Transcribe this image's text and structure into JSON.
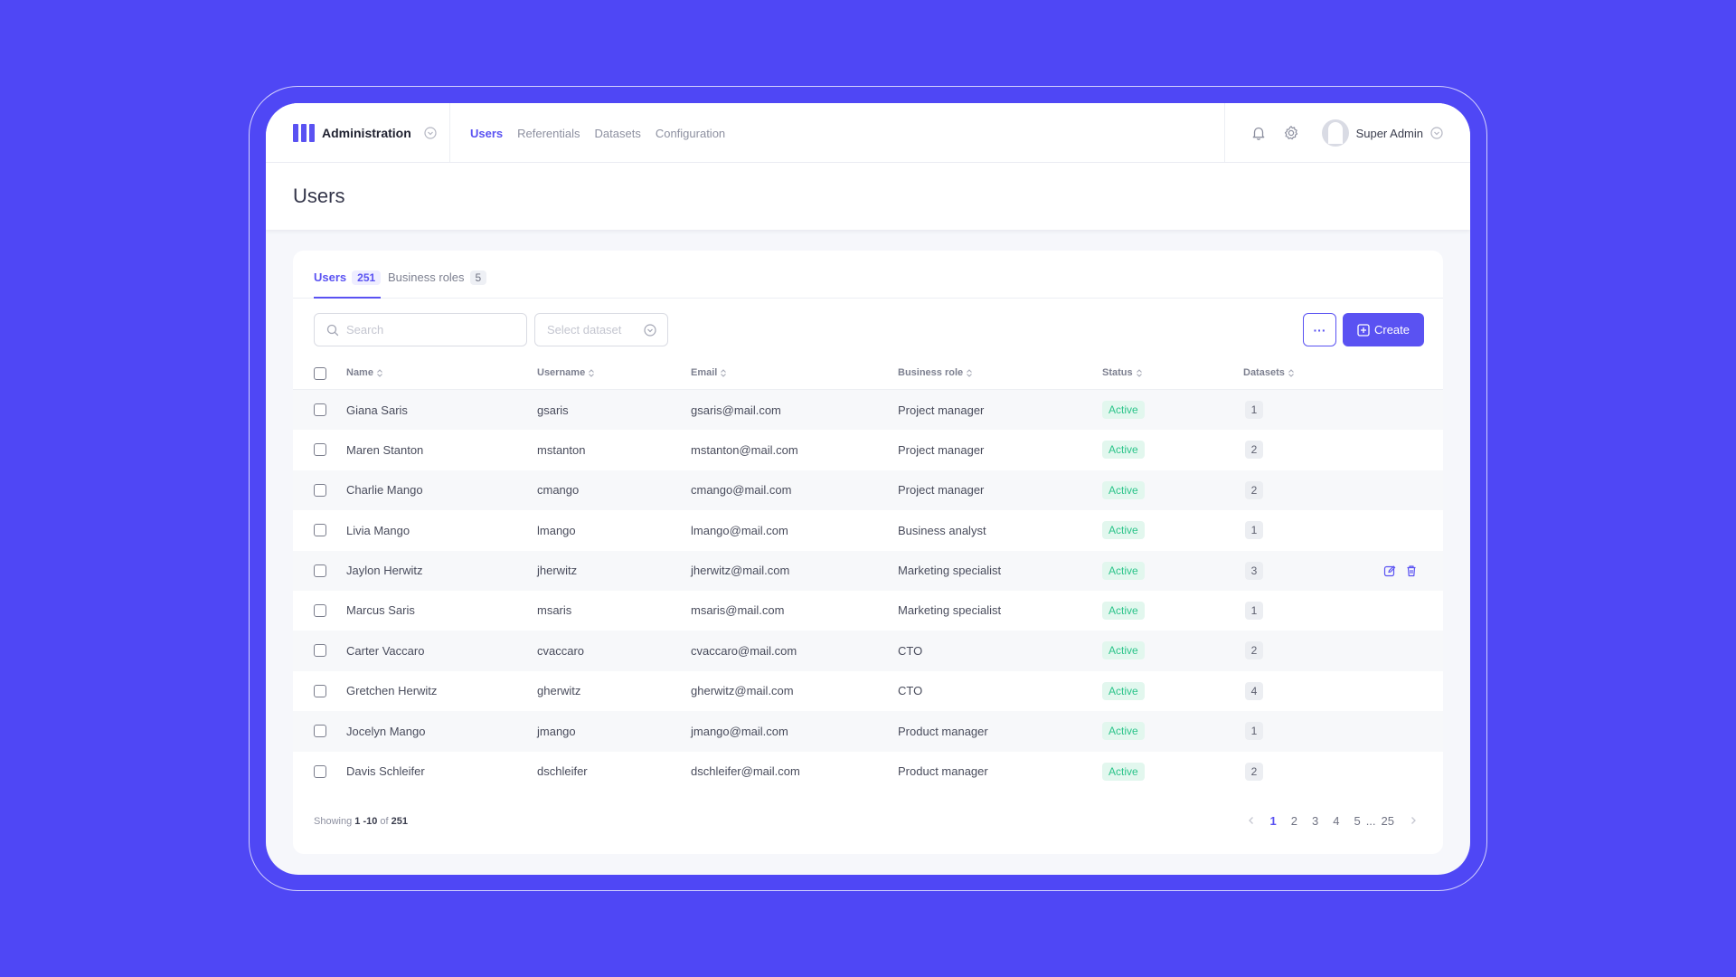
{
  "brand": {
    "name": "Administration"
  },
  "nav": [
    {
      "label": "Users",
      "active": true
    },
    {
      "label": "Referentials"
    },
    {
      "label": "Datasets"
    },
    {
      "label": "Configuration"
    }
  ],
  "user": {
    "name": "Super Admin"
  },
  "page": {
    "title": "Users"
  },
  "tabs": [
    {
      "label": "Users",
      "count": "251",
      "active": true
    },
    {
      "label": "Business roles",
      "count": "5"
    }
  ],
  "toolbar": {
    "search_placeholder": "Search",
    "dataset_placeholder": "Select dataset",
    "more_label": "···",
    "create_label": "Create"
  },
  "table": {
    "headers": [
      "Name",
      "Username",
      "Email",
      "Business role",
      "Status",
      "Datasets"
    ],
    "rows": [
      {
        "name": "Giana Saris",
        "username": "gsaris",
        "email": "gsaris@mail.com",
        "role": "Project manager",
        "status": "Active",
        "datasets": "1"
      },
      {
        "name": "Maren Stanton",
        "username": "mstanton",
        "email": "mstanton@mail.com",
        "role": "Project manager",
        "status": "Active",
        "datasets": "2"
      },
      {
        "name": "Charlie Mango",
        "username": "cmango",
        "email": "cmango@mail.com",
        "role": "Project manager",
        "status": "Active",
        "datasets": "2"
      },
      {
        "name": "Livia Mango",
        "username": "lmango",
        "email": "lmango@mail.com",
        "role": "Business analyst",
        "status": "Active",
        "datasets": "1"
      },
      {
        "name": "Jaylon Herwitz",
        "username": "jherwitz",
        "email": "jherwitz@mail.com",
        "role": "Marketing specialist",
        "status": "Active",
        "datasets": "3",
        "show_actions": true
      },
      {
        "name": "Marcus Saris",
        "username": "msaris",
        "email": "msaris@mail.com",
        "role": "Marketing specialist",
        "status": "Active",
        "datasets": "1"
      },
      {
        "name": "Carter Vaccaro",
        "username": "cvaccaro",
        "email": "cvaccaro@mail.com",
        "role": "CTO",
        "status": "Active",
        "datasets": "2"
      },
      {
        "name": "Gretchen Herwitz",
        "username": "gherwitz",
        "email": "gherwitz@mail.com",
        "role": "CTO",
        "status": "Active",
        "datasets": "4"
      },
      {
        "name": "Jocelyn Mango",
        "username": "jmango",
        "email": "jmango@mail.com",
        "role": "Product manager",
        "status": "Active",
        "datasets": "1"
      },
      {
        "name": "Davis Schleifer",
        "username": "dschleifer",
        "email": "dschleifer@mail.com",
        "role": "Product manager",
        "status": "Active",
        "datasets": "2"
      }
    ]
  },
  "footer": {
    "showing_prefix": "Showing",
    "range": "1 -10",
    "of": "of",
    "total": "251"
  },
  "pagination": {
    "pages": [
      "1",
      "2",
      "3",
      "4",
      "5"
    ],
    "current": "1",
    "ellipsis": "...",
    "last": "25"
  },
  "colors": {
    "background": "#4f47f5",
    "accent": "#5a52f2",
    "active_status": "#2bc48a"
  },
  "icons": {
    "logo": "bars-logo-icon",
    "bell": "bell-icon",
    "settings": "gear-icon",
    "search": "search-icon",
    "edit": "edit-icon",
    "delete": "trash-icon"
  }
}
